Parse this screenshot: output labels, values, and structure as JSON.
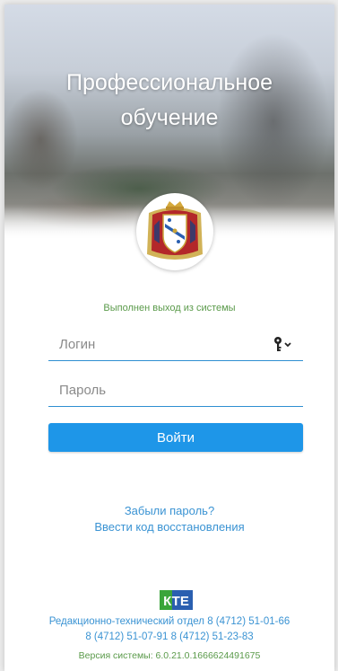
{
  "hero": {
    "title_line1": "Профессиональное",
    "title_line2": "обучение"
  },
  "emblem": {
    "icon": "coat-of-arms-icon"
  },
  "status": {
    "message": "Выполнен выход из системы"
  },
  "login": {
    "placeholder": "Логин",
    "value": "",
    "icon": "key-icon"
  },
  "password": {
    "placeholder": "Пароль",
    "value": ""
  },
  "submit": {
    "label": "Войти"
  },
  "links": {
    "forgot": "Забыли пароль?",
    "recovery": "Ввести код восстановления"
  },
  "footer": {
    "logo_text": "КТЕ",
    "department": "Редакционно-технический отдел 8 (4712) 51-01-66",
    "phones": "8 (4712) 51-07-91  8 (4712) 51-23-83",
    "version": "Версия системы: 6.0.21.0.1666624491675"
  },
  "colors": {
    "accent": "#1e96e8",
    "link": "#3a93d3",
    "status_green": "#5a9a4a",
    "logo_green": "#3aa53a",
    "logo_blue": "#2a5fb0"
  }
}
